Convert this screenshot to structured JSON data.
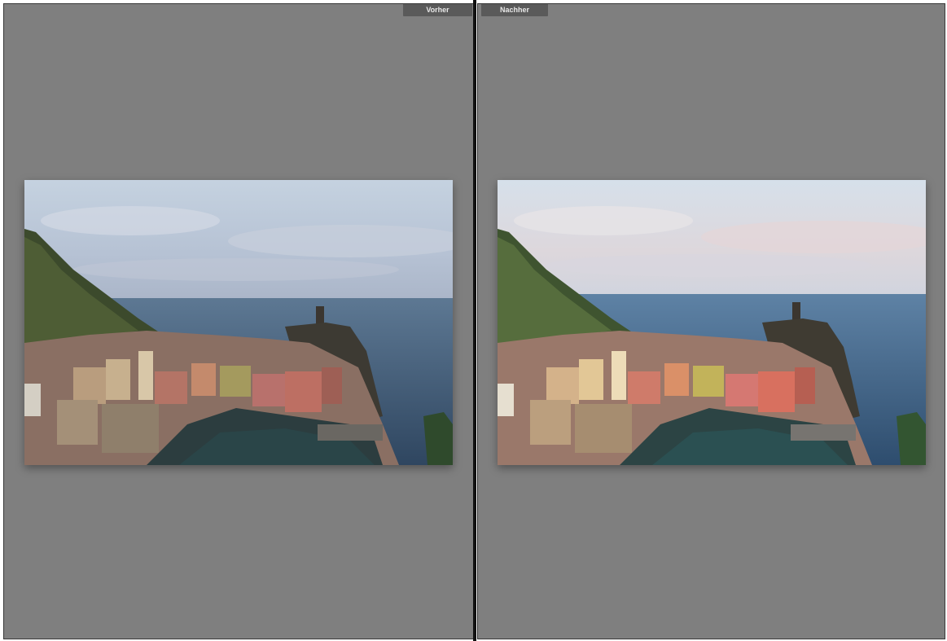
{
  "view": {
    "before_label": "Vorher",
    "after_label": "Nachher"
  },
  "colors": {
    "pane_background": "#7f7f7f",
    "divider": "#111111",
    "tab_background": "#5a5a5a",
    "tab_text": "#e8e8e8"
  },
  "photos": {
    "before": {
      "icon": "photo-vernazza-before",
      "tone": "flat"
    },
    "after": {
      "icon": "photo-vernazza-after",
      "tone": "enhanced"
    }
  }
}
